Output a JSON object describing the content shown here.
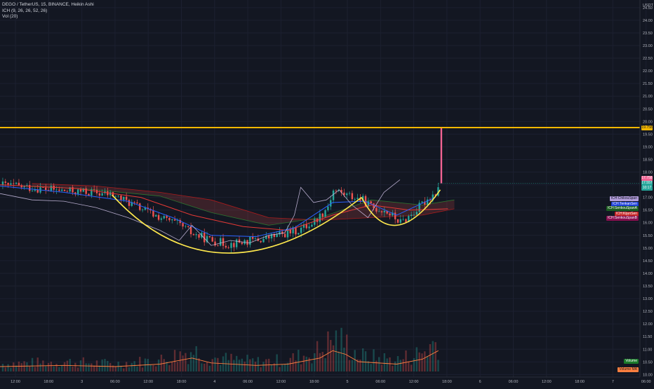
{
  "legend": {
    "symbol_line": "DEGO / TetherUS, 15, BINANCE, Heikin Ashi",
    "ichimoku_line": "ICH (9, 26, 26, 52, 26)",
    "volume_line": "Vol (20)"
  },
  "currency_label": "USDT",
  "colors": {
    "background": "#131722",
    "resistance": "#f5b700",
    "cup_curve": "#ffe94d",
    "up_candle": "#26a69a",
    "down_candle": "#ef5350",
    "pump_candle": "#f06292",
    "chikou": "#d1c4e9",
    "tenkan": "#2962ff",
    "kijun": "#e53935",
    "volume_ma": "#ff7f3f"
  },
  "price_badges": [
    {
      "label": "19.758",
      "value": 19.758,
      "color": "#f5b700",
      "text_color": "#131722"
    },
    {
      "label": "17.758",
      "value": 17.758,
      "color": "#f06292",
      "text_color": "#ffffff"
    },
    {
      "label": "17.557",
      "value": 17.557,
      "color": "#26a69a",
      "text_color": "#ffffff"
    },
    {
      "label": "10:17",
      "value": 17.37,
      "color": "#26a69a",
      "text_color": "#ffffff"
    }
  ],
  "indicator_tags": [
    {
      "label": "ICH:ChikouSpan",
      "color": "#b39ddb",
      "text_color": "#131722",
      "value": 16.95
    },
    {
      "label": "ICH:TenkanSen",
      "color": "#1e3fd8",
      "text_color": "#ffffff",
      "value": 16.74
    },
    {
      "label": "ICH:SenkouSpanA",
      "color": "#1b5e20",
      "text_color": "#ffffff",
      "value": 16.57
    },
    {
      "label": "ICH:KijunSen",
      "color": "#c62828",
      "text_color": "#ffffff",
      "value": 16.35
    },
    {
      "label": "ICH:SenkouSpanB",
      "color": "#880e4f",
      "text_color": "#ffffff",
      "value": 16.18
    }
  ],
  "volume_tags": [
    {
      "label": "Volume",
      "color": "#1b7a2b",
      "text_color": "#ffffff",
      "value": 10.52
    },
    {
      "label": "Volume MA",
      "color": "#ff7f3f",
      "text_color": "#131722",
      "value": 10.18
    }
  ],
  "chart_data": {
    "type": "candlestick",
    "title": "DEGO / TetherUS, 15, BINANCE, Heikin Ashi",
    "ylim": [
      9.9,
      24.8
    ],
    "y_ticks": [
      "24.50",
      "24.00",
      "23.50",
      "23.00",
      "22.50",
      "22.00",
      "21.50",
      "21.00",
      "20.50",
      "20.00",
      "19.50",
      "19.00",
      "18.50",
      "18.00",
      "17.50",
      "17.00",
      "16.50",
      "16.00",
      "15.50",
      "15.00",
      "14.50",
      "14.00",
      "13.50",
      "13.00",
      "12.50",
      "12.00",
      "11.50",
      "11.00",
      "10.50",
      "10.00"
    ],
    "x_ticks": [
      "12:00",
      "18:00",
      "3",
      "06:00",
      "12:00",
      "18:00",
      "4",
      "06:00",
      "12:00",
      "18:00",
      "5",
      "06:00",
      "12:00",
      "18:00",
      "6",
      "06:00",
      "12:00",
      "18:00",
      "7",
      "06:00"
    ],
    "resistance_level": 19.758,
    "last_price": 17.557,
    "spike_high": 19.758,
    "price_path": [
      {
        "t": 0,
        "p": 17.5
      },
      {
        "t": 0.06,
        "p": 17.35
      },
      {
        "t": 0.1,
        "p": 17.25
      },
      {
        "t": 0.14,
        "p": 17.2
      },
      {
        "t": 0.175,
        "p": 17.1
      },
      {
        "t": 0.2,
        "p": 16.8
      },
      {
        "t": 0.24,
        "p": 16.3
      },
      {
        "t": 0.28,
        "p": 15.9
      },
      {
        "t": 0.3,
        "p": 15.55
      },
      {
        "t": 0.33,
        "p": 15.3
      },
      {
        "t": 0.355,
        "p": 15.15
      },
      {
        "t": 0.38,
        "p": 15.25
      },
      {
        "t": 0.41,
        "p": 15.35
      },
      {
        "t": 0.44,
        "p": 15.55
      },
      {
        "t": 0.465,
        "p": 15.7
      },
      {
        "t": 0.49,
        "p": 16.05
      },
      {
        "t": 0.51,
        "p": 16.6
      },
      {
        "t": 0.52,
        "p": 17.3
      },
      {
        "t": 0.54,
        "p": 17.1
      },
      {
        "t": 0.565,
        "p": 16.9
      },
      {
        "t": 0.58,
        "p": 16.6
      },
      {
        "t": 0.6,
        "p": 16.5
      },
      {
        "t": 0.625,
        "p": 16.0
      },
      {
        "t": 0.645,
        "p": 16.4
      },
      {
        "t": 0.665,
        "p": 16.9
      },
      {
        "t": 0.68,
        "p": 17.2
      },
      {
        "t": 0.685,
        "p": 17.55
      }
    ],
    "cup_curve": [
      {
        "t": 0.175,
        "p": 17.1
      },
      {
        "t": 0.355,
        "p": 14.8
      },
      {
        "t": 0.565,
        "p": 17.0
      }
    ],
    "handle_curve": [
      {
        "t": 0.565,
        "p": 17.0
      },
      {
        "t": 0.62,
        "p": 15.9
      },
      {
        "t": 0.688,
        "p": 17.3
      }
    ],
    "chikou_span": [
      {
        "t": 0.0,
        "p": 17.15
      },
      {
        "t": 0.05,
        "p": 16.9
      },
      {
        "t": 0.1,
        "p": 16.85
      },
      {
        "t": 0.15,
        "p": 16.6
      },
      {
        "t": 0.2,
        "p": 16.2
      },
      {
        "t": 0.25,
        "p": 15.7
      },
      {
        "t": 0.28,
        "p": 15.3
      },
      {
        "t": 0.3,
        "p": 15.9
      },
      {
        "t": 0.33,
        "p": 15.1
      },
      {
        "t": 0.36,
        "p": 15.3
      },
      {
        "t": 0.39,
        "p": 15.2
      },
      {
        "t": 0.42,
        "p": 15.5
      },
      {
        "t": 0.445,
        "p": 15.6
      },
      {
        "t": 0.46,
        "p": 16.3
      },
      {
        "t": 0.47,
        "p": 17.4
      },
      {
        "t": 0.49,
        "p": 16.8
      },
      {
        "t": 0.51,
        "p": 16.9
      },
      {
        "t": 0.53,
        "p": 17.3
      },
      {
        "t": 0.55,
        "p": 16.7
      },
      {
        "t": 0.575,
        "p": 16.2
      },
      {
        "t": 0.6,
        "p": 17.2
      },
      {
        "t": 0.625,
        "p": 17.7
      }
    ],
    "tenkan_sen": [
      {
        "t": 0.0,
        "p": 17.45
      },
      {
        "t": 0.1,
        "p": 17.2
      },
      {
        "t": 0.2,
        "p": 16.85
      },
      {
        "t": 0.27,
        "p": 16.2
      },
      {
        "t": 0.33,
        "p": 15.5
      },
      {
        "t": 0.4,
        "p": 15.45
      },
      {
        "t": 0.46,
        "p": 15.8
      },
      {
        "t": 0.52,
        "p": 16.8
      },
      {
        "t": 0.57,
        "p": 16.85
      },
      {
        "t": 0.62,
        "p": 16.3
      },
      {
        "t": 0.68,
        "p": 17.0
      }
    ],
    "kijun_sen": [
      {
        "t": 0.0,
        "p": 17.5
      },
      {
        "t": 0.12,
        "p": 17.35
      },
      {
        "t": 0.22,
        "p": 17.0
      },
      {
        "t": 0.3,
        "p": 16.3
      },
      {
        "t": 0.38,
        "p": 15.85
      },
      {
        "t": 0.45,
        "p": 15.7
      },
      {
        "t": 0.52,
        "p": 16.3
      },
      {
        "t": 0.58,
        "p": 16.7
      },
      {
        "t": 0.64,
        "p": 16.5
      },
      {
        "t": 0.7,
        "p": 16.55
      }
    ],
    "senkou_a": [
      {
        "t": 0.05,
        "p": 17.45
      },
      {
        "t": 0.15,
        "p": 17.3
      },
      {
        "t": 0.25,
        "p": 17.05
      },
      {
        "t": 0.33,
        "p": 16.4
      },
      {
        "t": 0.42,
        "p": 15.9
      },
      {
        "t": 0.5,
        "p": 16.2
      },
      {
        "t": 0.58,
        "p": 16.9
      },
      {
        "t": 0.66,
        "p": 16.7
      },
      {
        "t": 0.71,
        "p": 16.9
      }
    ],
    "senkou_b": [
      {
        "t": 0.05,
        "p": 17.55
      },
      {
        "t": 0.15,
        "p": 17.45
      },
      {
        "t": 0.25,
        "p": 17.2
      },
      {
        "t": 0.33,
        "p": 16.9
      },
      {
        "t": 0.42,
        "p": 16.2
      },
      {
        "t": 0.5,
        "p": 16.1
      },
      {
        "t": 0.58,
        "p": 16.2
      },
      {
        "t": 0.66,
        "p": 16.3
      },
      {
        "t": 0.71,
        "p": 16.55
      }
    ],
    "volume_ma": [
      {
        "t": 0.0,
        "p": 0.2
      },
      {
        "t": 0.1,
        "p": 0.25
      },
      {
        "t": 0.18,
        "p": 0.2
      },
      {
        "t": 0.25,
        "p": 0.3
      },
      {
        "t": 0.3,
        "p": 0.55
      },
      {
        "t": 0.33,
        "p": 0.35
      },
      {
        "t": 0.4,
        "p": 0.25
      },
      {
        "t": 0.45,
        "p": 0.3
      },
      {
        "t": 0.5,
        "p": 0.55
      },
      {
        "t": 0.52,
        "p": 0.85
      },
      {
        "t": 0.54,
        "p": 0.7
      },
      {
        "t": 0.56,
        "p": 0.4
      },
      {
        "t": 0.62,
        "p": 0.3
      },
      {
        "t": 0.66,
        "p": 0.5
      },
      {
        "t": 0.685,
        "p": 0.85
      }
    ]
  }
}
